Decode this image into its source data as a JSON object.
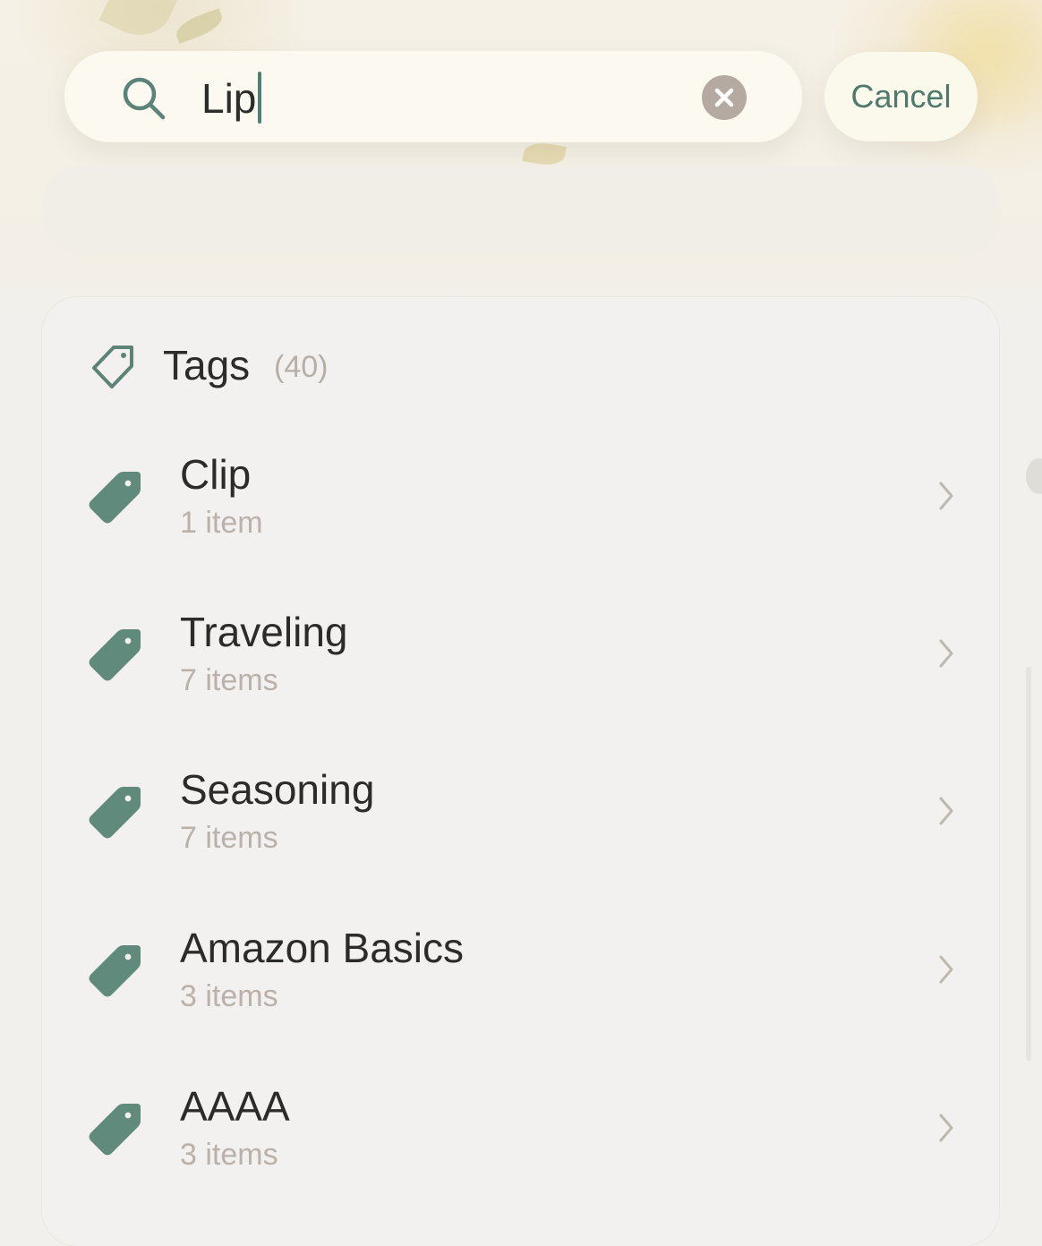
{
  "search": {
    "value": "Lip"
  },
  "header": {
    "cancel_label": "Cancel"
  },
  "tags_section": {
    "title": "Tags",
    "count": "(40)",
    "items": [
      {
        "name": "Clip",
        "subtitle": "1 item"
      },
      {
        "name": "Traveling",
        "subtitle": "7 items"
      },
      {
        "name": "Seasoning",
        "subtitle": "7 items"
      },
      {
        "name": "Amazon Basics",
        "subtitle": "3 items"
      },
      {
        "name": "AAAA",
        "subtitle": "3 items"
      }
    ]
  },
  "colors": {
    "accent": "#5b8377",
    "tag_fill": "#5f8a7c",
    "cancel_text": "#4d7a6d",
    "muted_text": "#b9b1aa",
    "clear_button": "#b5aaa1"
  },
  "icons": {
    "search": "search-icon",
    "clear": "clear-icon",
    "section": "tag-outline-icon",
    "row": "tag-filled-icon",
    "row_action": "chevron-right-icon"
  }
}
